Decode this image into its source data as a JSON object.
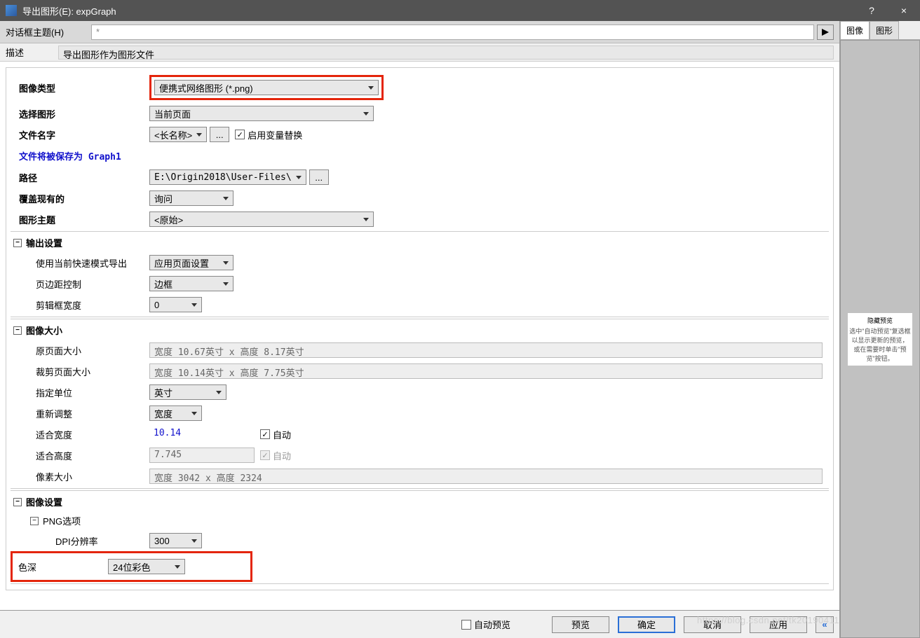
{
  "window": {
    "title": "导出图形(E): expGraph",
    "help": "?",
    "close": "×"
  },
  "theme_row": {
    "label": "对话框主题(H)",
    "value": "*"
  },
  "desc_row": {
    "label": "描述",
    "value": "导出图形作为图形文件"
  },
  "fields": {
    "image_type": {
      "label": "图像类型",
      "value": "便携式网络图形 (*.png)"
    },
    "select_graph": {
      "label": "选择图形",
      "value": "当前页面"
    },
    "file_name": {
      "label": "文件名字",
      "value": "<长名称>",
      "browse": "...",
      "checkbox": "启用变量替换"
    },
    "save_msg": "文件将被保存为 Graph1",
    "path": {
      "label": "路径",
      "value": "E:\\Origin2018\\User-Files\\",
      "browse": "..."
    },
    "overwrite": {
      "label": "覆盖现有的",
      "value": "询问"
    },
    "graph_theme": {
      "label": "图形主题",
      "value": "<原始>"
    }
  },
  "output": {
    "title": "输出设置",
    "fast_mode": {
      "label": "使用当前快速模式导出",
      "value": "应用页面设置"
    },
    "margin": {
      "label": "页边距控制",
      "value": "边框"
    },
    "clip_width": {
      "label": "剪辑框宽度",
      "value": "0"
    }
  },
  "img_size": {
    "title": "图像大小",
    "original": {
      "label": "原页面大小",
      "value": "宽度 10.67英寸 x 高度 8.17英寸"
    },
    "cropped": {
      "label": "裁剪页面大小",
      "value": "宽度 10.14英寸 x 高度 7.75英寸"
    },
    "unit": {
      "label": "指定单位",
      "value": "英寸"
    },
    "rescale": {
      "label": "重新调整",
      "value": "宽度"
    },
    "fit_w": {
      "label": "适合宽度",
      "value": "10.14",
      "auto": "自动"
    },
    "fit_h": {
      "label": "适合高度",
      "value": "7.745",
      "auto": "自动"
    },
    "pixel": {
      "label": "像素大小",
      "value": "宽度 3042 x 高度 2324"
    }
  },
  "img_set": {
    "title": "图像设置",
    "png": "PNG选项",
    "dpi": {
      "label": "DPI分辨率",
      "value": "300"
    },
    "depth": {
      "label": "色深",
      "value": "24位彩色"
    }
  },
  "bottom": {
    "auto_preview": "自动预览",
    "preview": "预览",
    "ok": "确定",
    "cancel": "取消",
    "apply": "应用"
  },
  "rtabs": {
    "image": "图像",
    "graph": "图形"
  },
  "preview_panel": {
    "title": "隐藏预览",
    "hint1": "选中\"自动预览\"复选框",
    "hint2": "以显示更新的预览，",
    "hint3": "或在需要时单击\"预览\"按钮。"
  },
  "watermark": "https://blog.csdn.net/tk20190411"
}
